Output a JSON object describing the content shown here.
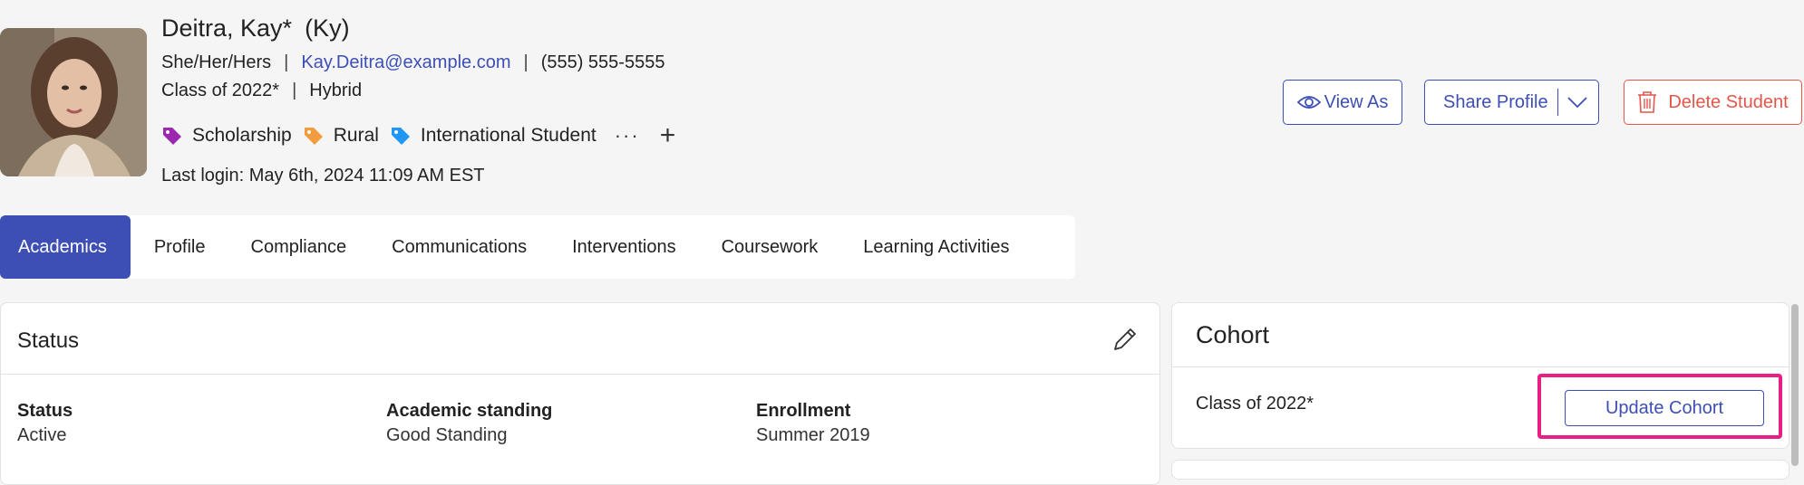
{
  "student": {
    "name": "Deitra, Kay*",
    "nickname": "(Ky)",
    "pronouns": "She/Her/Hers",
    "email": "Kay.Deitra@example.com",
    "phone": "(555) 555-5555",
    "class": "Class of 2022*",
    "modality": "Hybrid",
    "separator": "|",
    "last_login": "Last login: May 6th, 2024 11:09 AM EST"
  },
  "tags": [
    {
      "label": "Scholarship",
      "color": "#9c27b0",
      "icon": "tag-icon"
    },
    {
      "label": "Rural",
      "color": "#f39c3d",
      "icon": "tag-icon"
    },
    {
      "label": "International Student",
      "color": "#2196f3",
      "icon": "tag-icon"
    }
  ],
  "tag_actions": {
    "more": "···",
    "add": "+"
  },
  "actions": {
    "view_as": "View As",
    "share_profile": "Share Profile",
    "delete_student": "Delete Student"
  },
  "tabs": [
    {
      "label": "Academics",
      "active": true
    },
    {
      "label": "Profile"
    },
    {
      "label": "Compliance"
    },
    {
      "label": "Communications"
    },
    {
      "label": "Interventions"
    },
    {
      "label": "Coursework"
    },
    {
      "label": "Learning Activities"
    }
  ],
  "status_card": {
    "title": "Status",
    "fields": [
      {
        "label": "Status",
        "value": "Active"
      },
      {
        "label": "Academic standing",
        "value": "Good Standing"
      },
      {
        "label": "Enrollment",
        "value": "Summer 2019"
      }
    ]
  },
  "cohort_card": {
    "title": "Cohort",
    "value": "Class of 2022*",
    "button": "Update Cohort"
  },
  "colors": {
    "accent": "#3d4fb5",
    "danger": "#e2574c",
    "highlight": "#ea1f86"
  }
}
